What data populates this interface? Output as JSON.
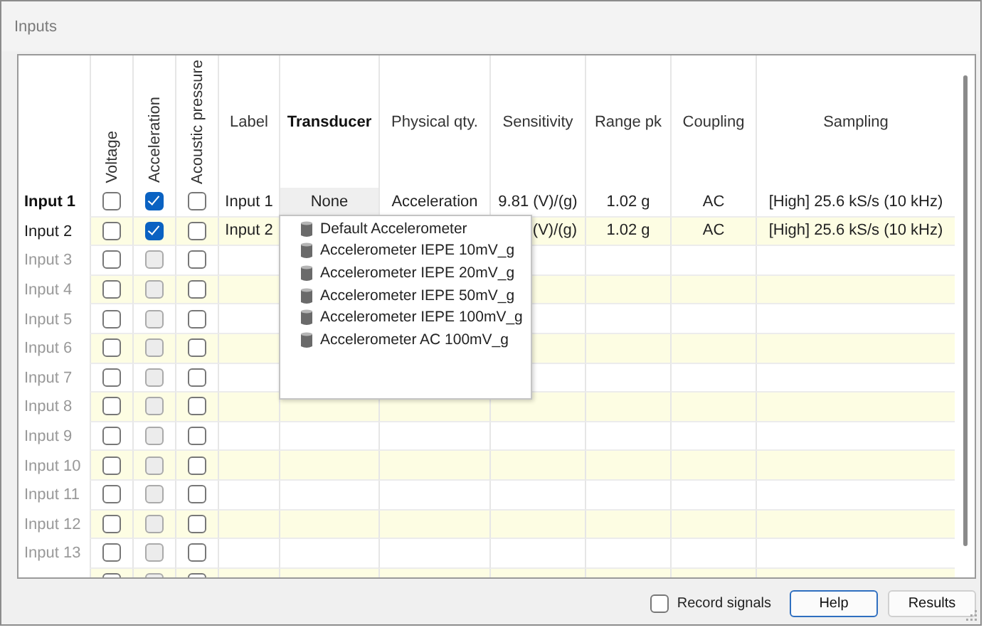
{
  "window": {
    "title": "Inputs"
  },
  "table": {
    "columns": [
      {
        "label": "Voltage",
        "kind": "vertical",
        "active": false
      },
      {
        "label": "Acceleration",
        "kind": "vertical",
        "active": false
      },
      {
        "label": "Acoustic pressure",
        "kind": "vertical",
        "active": false
      },
      {
        "label": "Label",
        "kind": "plain",
        "active": false
      },
      {
        "label": "Transducer",
        "kind": "plain",
        "active": true
      },
      {
        "label": "Physical qty.",
        "kind": "plain",
        "active": false
      },
      {
        "label": "Sensitivity",
        "kind": "plain",
        "active": false
      },
      {
        "label": "Range pk",
        "kind": "plain",
        "active": false
      },
      {
        "label": "Coupling",
        "kind": "plain",
        "active": false
      },
      {
        "label": "Sampling",
        "kind": "plain",
        "active": false
      }
    ],
    "rows": [
      {
        "name": "Input 1",
        "selected": true,
        "disabled": false,
        "checks": [
          {
            "checked": false,
            "disabled": false
          },
          {
            "checked": true,
            "disabled": false
          },
          {
            "checked": false,
            "disabled": false
          }
        ],
        "label": "Input 1",
        "transducer": "None",
        "transducer_focused": true,
        "physical_qty": "Acceleration",
        "sensitivity": "9.81 (V)/(g)",
        "range_pk": "1.02 g",
        "coupling": "AC",
        "sampling": "[High] 25.6 kS/s (10 kHz)"
      },
      {
        "name": "Input 2",
        "selected": false,
        "disabled": false,
        "checks": [
          {
            "checked": false,
            "disabled": false
          },
          {
            "checked": true,
            "disabled": false
          },
          {
            "checked": false,
            "disabled": false
          }
        ],
        "label": "Input 2",
        "sensitivity": "(V)/(g)",
        "sensitivity_covered": true,
        "range_pk": "1.02 g",
        "coupling": "AC",
        "sampling": "[High] 25.6 kS/s (10 kHz)"
      },
      {
        "name": "Input 3",
        "selected": false,
        "disabled": true,
        "checks": [
          {
            "checked": false,
            "disabled": false
          },
          {
            "checked": false,
            "disabled": true
          },
          {
            "checked": false,
            "disabled": false
          }
        ]
      },
      {
        "name": "Input 4",
        "selected": false,
        "disabled": true,
        "checks": [
          {
            "checked": false,
            "disabled": false
          },
          {
            "checked": false,
            "disabled": true
          },
          {
            "checked": false,
            "disabled": false
          }
        ]
      },
      {
        "name": "Input 5",
        "selected": false,
        "disabled": true,
        "checks": [
          {
            "checked": false,
            "disabled": false
          },
          {
            "checked": false,
            "disabled": true
          },
          {
            "checked": false,
            "disabled": false
          }
        ]
      },
      {
        "name": "Input 6",
        "selected": false,
        "disabled": true,
        "checks": [
          {
            "checked": false,
            "disabled": false
          },
          {
            "checked": false,
            "disabled": true
          },
          {
            "checked": false,
            "disabled": false
          }
        ]
      },
      {
        "name": "Input 7",
        "selected": false,
        "disabled": true,
        "checks": [
          {
            "checked": false,
            "disabled": false
          },
          {
            "checked": false,
            "disabled": true
          },
          {
            "checked": false,
            "disabled": false
          }
        ]
      },
      {
        "name": "Input 8",
        "selected": false,
        "disabled": true,
        "checks": [
          {
            "checked": false,
            "disabled": false
          },
          {
            "checked": false,
            "disabled": true
          },
          {
            "checked": false,
            "disabled": false
          }
        ]
      },
      {
        "name": "Input 9",
        "selected": false,
        "disabled": true,
        "checks": [
          {
            "checked": false,
            "disabled": false
          },
          {
            "checked": false,
            "disabled": true
          },
          {
            "checked": false,
            "disabled": false
          }
        ]
      },
      {
        "name": "Input 10",
        "selected": false,
        "disabled": true,
        "checks": [
          {
            "checked": false,
            "disabled": false
          },
          {
            "checked": false,
            "disabled": true
          },
          {
            "checked": false,
            "disabled": false
          }
        ]
      },
      {
        "name": "Input 11",
        "selected": false,
        "disabled": true,
        "checks": [
          {
            "checked": false,
            "disabled": false
          },
          {
            "checked": false,
            "disabled": true
          },
          {
            "checked": false,
            "disabled": false
          }
        ]
      },
      {
        "name": "Input 12",
        "selected": false,
        "disabled": true,
        "checks": [
          {
            "checked": false,
            "disabled": false
          },
          {
            "checked": false,
            "disabled": true
          },
          {
            "checked": false,
            "disabled": false
          }
        ]
      },
      {
        "name": "Input 13",
        "selected": false,
        "disabled": true,
        "checks": [
          {
            "checked": false,
            "disabled": false
          },
          {
            "checked": false,
            "disabled": true
          },
          {
            "checked": false,
            "disabled": false
          }
        ]
      },
      {
        "checks": [
          {
            "checked": false,
            "disabled": false
          },
          {
            "checked": false,
            "disabled": true
          },
          {
            "checked": false,
            "disabled": false
          }
        ]
      }
    ],
    "dropdown": {
      "items": [
        "Default Accelerometer",
        "Accelerometer IEPE 10mV_g",
        "Accelerometer IEPE 20mV_g",
        "Accelerometer IEPE 50mV_g",
        "Accelerometer IEPE 100mV_g",
        "Accelerometer AC 100mV_g"
      ]
    }
  },
  "footer": {
    "record_signals": {
      "label": "Record signals",
      "checked": false
    },
    "buttons": [
      {
        "label": "Help",
        "focused": true
      },
      {
        "label": "Results",
        "focused": false
      }
    ]
  }
}
